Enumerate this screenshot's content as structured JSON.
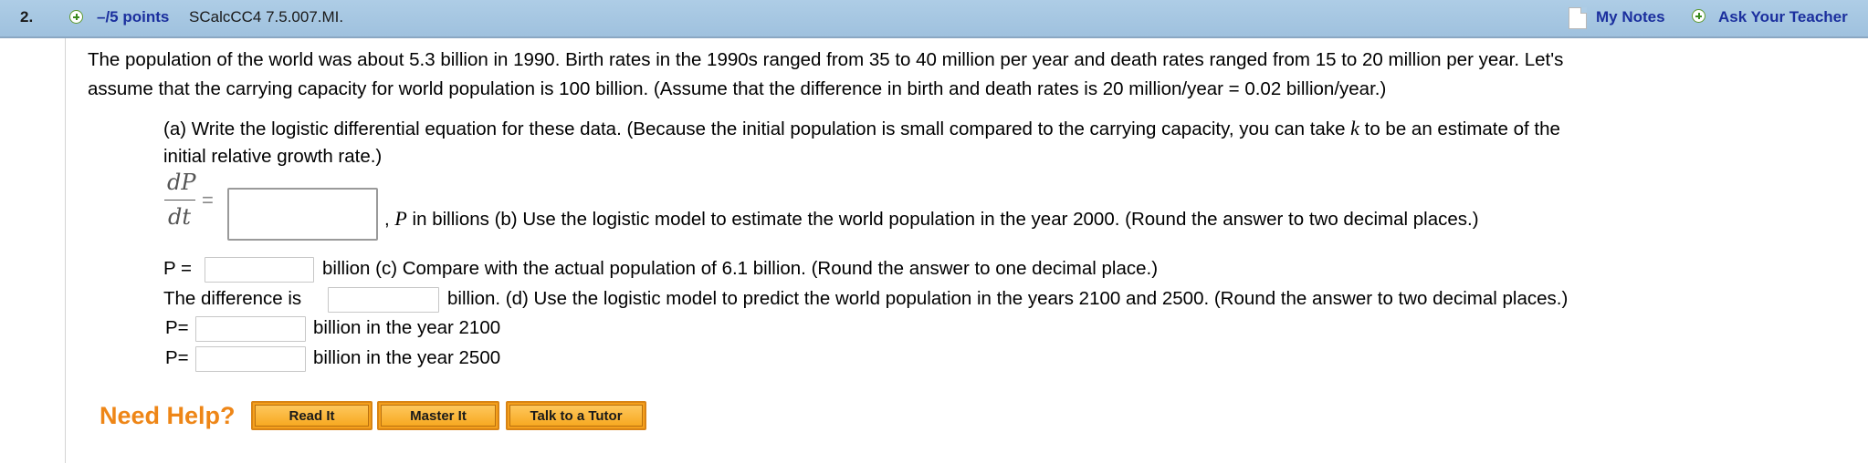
{
  "header": {
    "question_number": "2.",
    "points": "–/5 points",
    "question_code": "SCalcCC4 7.5.007.MI.",
    "my_notes": "My Notes",
    "ask_teacher": "Ask Your Teacher"
  },
  "problem": {
    "intro_line1": "The population of the world was about 5.3 billion in 1990. Birth rates in the 1990s ranged from 35 to 40 million per year and death rates ranged from 15 to 20 million per year. Let's",
    "intro_line2": "assume that the carrying capacity for world population is 100 billion. (Assume that the difference in birth and death rates is 20 million/year = 0.02 billion/year.)",
    "part_a_line1_pre": "(a) Write the logistic differential equation for these data. (Because the initial population is small compared to the carrying capacity, you can take ",
    "part_a_k": "k",
    "part_a_line1_post": " to be an estimate of the",
    "part_a_line2": "initial relative growth rate.)",
    "frac_num": "dP",
    "frac_den": "dt",
    "frac_eq": "=",
    "after_eq_comma": ",",
    "P": "P",
    "after_eq_text": " in billions (b) Use the logistic model to estimate the world population in the year 2000. (Round the answer to two decimal places.)",
    "b_label": "P =",
    "b_after": "billion (c) Compare with the actual population of 6.1 billion. (Round the answer to one decimal place.)",
    "c_label": "The difference is",
    "c_after": "billion. (d) Use the logistic model to predict the world population in the years 2100 and 2500. (Round the answer to two decimal places.)",
    "d1_label": "P=",
    "d1_after": "billion in the year 2100",
    "d2_label": "P=",
    "d2_after": "billion in the year 2500"
  },
  "help": {
    "label": "Need Help?",
    "read_it": "Read It",
    "master_it": "Master It",
    "talk_to_tutor": "Talk to a Tutor"
  }
}
